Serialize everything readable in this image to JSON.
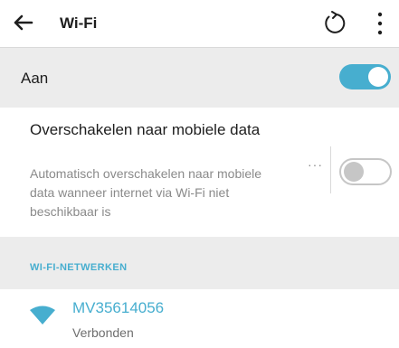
{
  "header": {
    "title": "Wi-Fi",
    "back_icon": "arrow-left-icon",
    "refresh_icon": "refresh-icon",
    "more_icon": "more-vertical-icon"
  },
  "wifi_toggle": {
    "label": "Aan",
    "state": "on"
  },
  "mobile_switch": {
    "title": "Overschakelen naar mobiele data",
    "description": "Automatisch overschakelen naar mobiele data wanneer internet via Wi-Fi niet beschikbaar is",
    "dots": "···",
    "state": "off"
  },
  "networks": {
    "section_label": "WI-FI-NETWERKEN",
    "items": [
      {
        "name": "MV35614056",
        "status": "Verbonden",
        "icon": "wifi-icon"
      }
    ]
  },
  "colors": {
    "accent": "#47aecf",
    "band_background": "#ececec",
    "toggle_off": "#c6c6c6",
    "secondary_text": "#8a8a8a"
  }
}
